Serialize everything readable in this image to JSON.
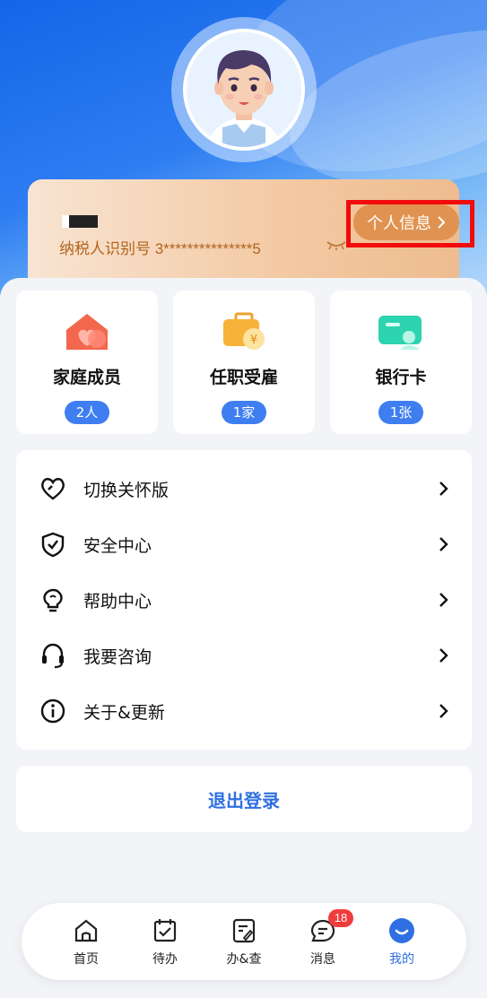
{
  "profile": {
    "taxid_label": "纳税人识别号 3***************5",
    "personal_info_label": "个人信息"
  },
  "tiles": [
    {
      "title": "家庭成员",
      "badge": "2人",
      "icon": "house-heart-icon"
    },
    {
      "title": "任职受雇",
      "badge": "1家",
      "icon": "briefcase-yuan-icon"
    },
    {
      "title": "银行卡",
      "badge": "1张",
      "icon": "bank-card-icon"
    }
  ],
  "menu": [
    {
      "label": "切换关怀版",
      "icon": "heart-icon"
    },
    {
      "label": "安全中心",
      "icon": "shield-check-icon"
    },
    {
      "label": "帮助中心",
      "icon": "lightbulb-icon"
    },
    {
      "label": "我要咨询",
      "icon": "headset-icon"
    },
    {
      "label": "关于&更新",
      "icon": "info-icon"
    }
  ],
  "logout_label": "退出登录",
  "tabbar": [
    {
      "label": "首页",
      "icon": "home-icon"
    },
    {
      "label": "待办",
      "icon": "calendar-check-icon"
    },
    {
      "label": "办&查",
      "icon": "document-edit-icon"
    },
    {
      "label": "消息",
      "icon": "chat-icon",
      "badge": "18"
    },
    {
      "label": "我的",
      "icon": "smile-icon",
      "active": true
    }
  ],
  "colors": {
    "primary": "#2f6fe3",
    "badge_red": "#f03c3c",
    "highlight": "#f20c0c",
    "personal_btn": "#e09250"
  }
}
